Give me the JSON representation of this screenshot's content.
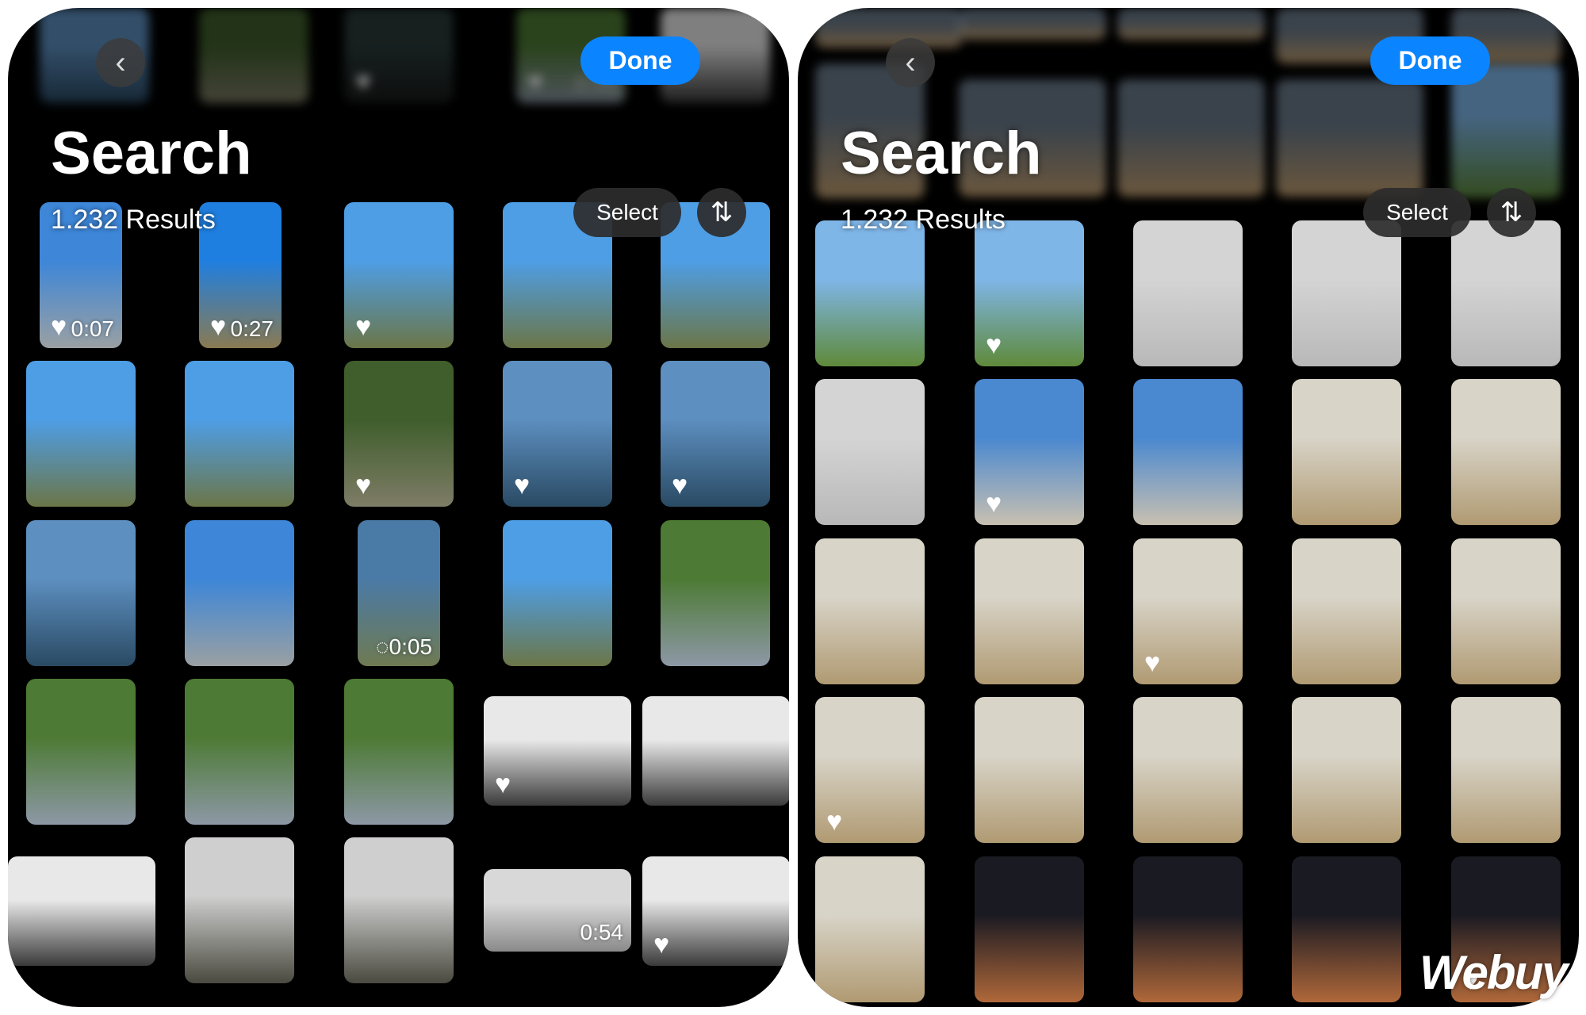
{
  "palette": {
    "sky-building": [
      "#3d86d8",
      "#9aa0a2"
    ],
    "sky-grass": [
      "#1f7fe0",
      "#8a7a52"
    ],
    "sky-trees": [
      "#4e9ee6",
      "#6b7648"
    ],
    "trees-shade": [
      "#3f5e2c",
      "#7e7c66"
    ],
    "glass": [
      "#5d8fc0",
      "#2a4a63"
    ],
    "path": [
      "#4a7aa6",
      "#6f7a52"
    ],
    "people-trees": [
      "#4d7a34",
      "#8d98a6"
    ],
    "hall": [
      "#e8e8e8",
      "#3a3a3a"
    ],
    "wall": [
      "#d4d4d4",
      "#b8b8b8"
    ],
    "wall-person": [
      "#cfcfcf",
      "#4a4a40"
    ],
    "hand": [
      "#d8d8d8",
      "#8a8a8a"
    ],
    "rainbow": [
      "#7fb6e8",
      "#5f8a3a"
    ],
    "sculpture": [
      "#4a88d0",
      "#c8c0b0"
    ],
    "canopy-person": [
      "#d8d4c8",
      "#b09a72"
    ],
    "stage": [
      "#1a1a22",
      "#b0683a"
    ],
    "blur-dark": [
      "#2a3a3a",
      "#1a1a1a"
    ],
    "blur-crowd": [
      "#6a7a8a",
      "#c4a070"
    ]
  },
  "colors": {
    "accent": "#0a84ff",
    "background": "#000000",
    "control": "#2d2d2d"
  },
  "left": {
    "back_icon": "chevron-left-icon",
    "done_label": "Done",
    "title": "Search",
    "results": "1.232 Results",
    "select_label": "Select",
    "sort_icon": "arrow-up-down-icon",
    "top_blurred": [
      {
        "tone": "glass"
      },
      {
        "tone": "trees-shade"
      },
      {
        "tone": "blur-dark",
        "heart": true
      },
      {
        "tone": "people-trees",
        "heart": true,
        "duration": "0:05"
      },
      {
        "tone": "hall"
      }
    ],
    "cells": [
      {
        "tone": "sky-building",
        "heart": true,
        "duration": "0:07"
      },
      {
        "tone": "sky-grass",
        "heart": true,
        "duration": "0:27"
      },
      {
        "tone": "sky-trees",
        "heart": true
      },
      {
        "tone": "sky-trees"
      },
      {
        "tone": "sky-trees"
      },
      {
        "tone": "sky-trees"
      },
      {
        "tone": "sky-trees"
      },
      {
        "tone": "trees-shade",
        "heart": true
      },
      {
        "tone": "glass",
        "heart": true
      },
      {
        "tone": "glass",
        "heart": true
      },
      {
        "tone": "glass"
      },
      {
        "tone": "sky-building"
      },
      {
        "tone": "path",
        "duration": "0:05",
        "live": true
      },
      {
        "tone": "sky-trees"
      },
      {
        "tone": "people-trees"
      },
      {
        "tone": "people-trees"
      },
      {
        "tone": "people-trees"
      },
      {
        "tone": "people-trees"
      },
      {
        "tone": "hall",
        "heart": true
      },
      {
        "tone": "hall"
      },
      {
        "tone": "hall"
      },
      {
        "tone": "wall-person"
      },
      {
        "tone": "wall-person"
      },
      {
        "tone": "hand",
        "duration": "0:54"
      },
      {
        "tone": "hall",
        "heart": true
      }
    ]
  },
  "right": {
    "back_icon": "chevron-left-icon",
    "done_label": "Done",
    "title": "Search",
    "results": "1.232 Results",
    "select_label": "Select",
    "sort_icon": "arrow-up-down-icon",
    "cells": [
      {
        "tone": "rainbow"
      },
      {
        "tone": "rainbow",
        "heart": true
      },
      {
        "tone": "wall"
      },
      {
        "tone": "wall"
      },
      {
        "tone": "wall"
      },
      {
        "tone": "wall"
      },
      {
        "tone": "sculpture",
        "heart": true
      },
      {
        "tone": "sculpture"
      },
      {
        "tone": "canopy-person"
      },
      {
        "tone": "canopy-person"
      },
      {
        "tone": "canopy-person"
      },
      {
        "tone": "canopy-person"
      },
      {
        "tone": "canopy-person",
        "heart": true
      },
      {
        "tone": "canopy-person"
      },
      {
        "tone": "canopy-person"
      },
      {
        "tone": "canopy-person",
        "heart": true
      },
      {
        "tone": "canopy-person"
      },
      {
        "tone": "canopy-person"
      },
      {
        "tone": "canopy-person"
      },
      {
        "tone": "canopy-person"
      },
      {
        "tone": "canopy-person"
      },
      {
        "tone": "stage"
      },
      {
        "tone": "stage"
      },
      {
        "tone": "stage"
      },
      {
        "tone": "stage",
        "heart": true
      }
    ]
  },
  "watermark": "Webuy"
}
